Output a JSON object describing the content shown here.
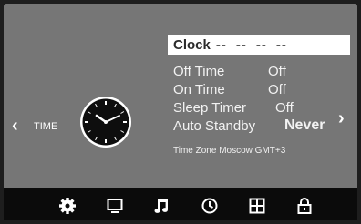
{
  "left_nav": {
    "label": "TIME",
    "arrow_icon": "chevron-left-icon"
  },
  "right_nav": {
    "arrow_icon": "chevron-right-icon"
  },
  "menu": {
    "clock": {
      "label": "Clock",
      "value": [
        "--",
        "--",
        "--",
        "--"
      ]
    },
    "off_time": {
      "label": "Off Time",
      "value": "Off"
    },
    "on_time": {
      "label": "On Time",
      "value": "Off"
    },
    "sleep_timer": {
      "label": "Sleep Timer",
      "value": "Off"
    },
    "auto_standby": {
      "label": "Auto Standby",
      "value": "Never"
    },
    "time_zone": "Time Zone Moscow GMT+3"
  },
  "bottom_bar": {
    "icons": [
      "gear-icon",
      "monitor-icon",
      "music-note-icon",
      "clock-icon",
      "grid-icon",
      "lock-icon"
    ],
    "active": "clock-icon"
  },
  "colors": {
    "screen_bg": "#767676",
    "bar_bg": "#0b0b0b",
    "highlight": "#ffffff"
  }
}
